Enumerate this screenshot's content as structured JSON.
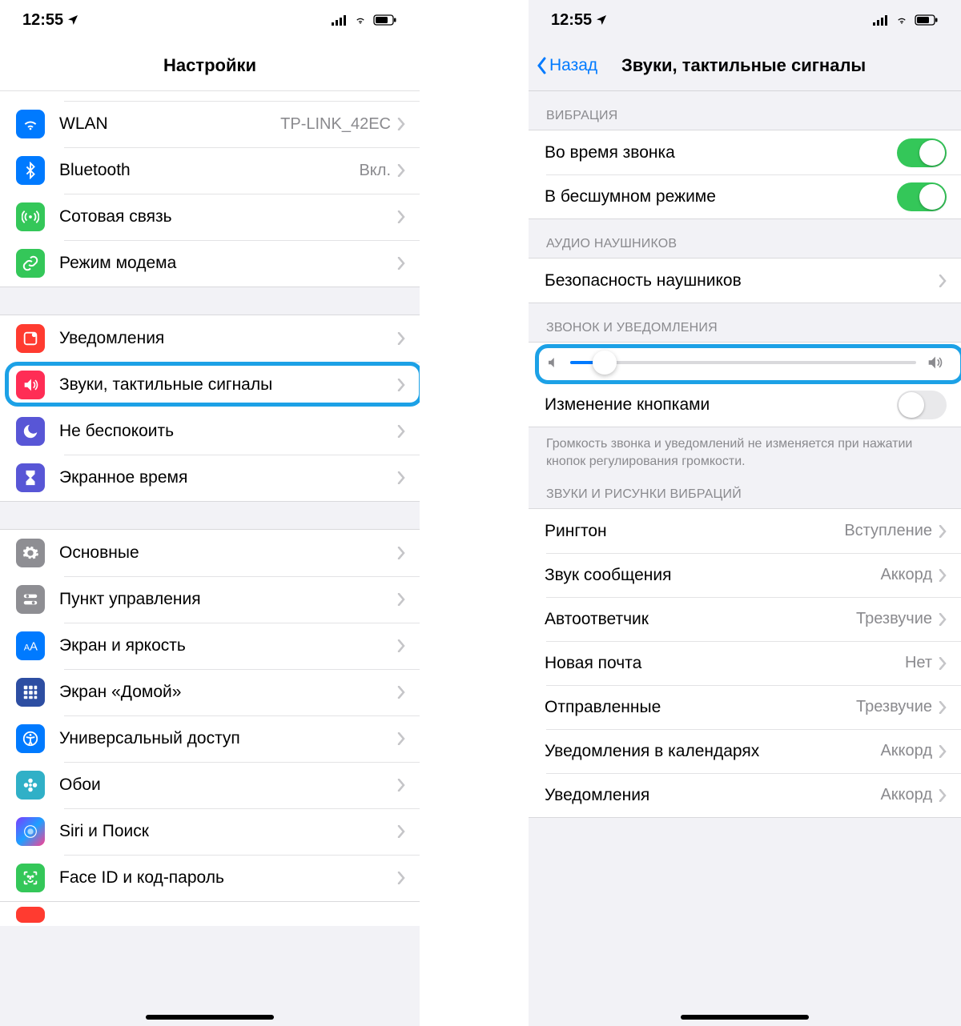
{
  "statusbar": {
    "time": "12:55"
  },
  "left": {
    "nav_title": "Настройки",
    "rows": {
      "wlan": {
        "label": "WLAN",
        "value": "TP-LINK_42EC",
        "icon_bg": "#007aff"
      },
      "bluetooth": {
        "label": "Bluetooth",
        "value": "Вкл.",
        "icon_bg": "#007aff"
      },
      "cellular": {
        "label": "Сотовая связь",
        "icon_bg": "#34c759"
      },
      "hotspot": {
        "label": "Режим модема",
        "icon_bg": "#34c759"
      },
      "notifications": {
        "label": "Уведомления",
        "icon_bg": "#ff3b30"
      },
      "sounds": {
        "label": "Звуки, тактильные сигналы",
        "icon_bg": "#ff2d55"
      },
      "dnd": {
        "label": "Не беспокоить",
        "icon_bg": "#5856d6"
      },
      "screentime": {
        "label": "Экранное время",
        "icon_bg": "#5856d6"
      },
      "general": {
        "label": "Основные",
        "icon_bg": "#8e8e93"
      },
      "controlcenter": {
        "label": "Пункт управления",
        "icon_bg": "#8e8e93"
      },
      "display": {
        "label": "Экран и яркость",
        "icon_bg": "#007aff"
      },
      "homescreen": {
        "label": "Экран «Домой»",
        "icon_bg": "#2d4ea2"
      },
      "accessibility": {
        "label": "Универсальный доступ",
        "icon_bg": "#007aff"
      },
      "wallpaper": {
        "label": "Обои",
        "icon_bg": "#30b0c7"
      },
      "siri": {
        "label": "Siri и Поиск",
        "icon_bg": "#1c1c1e"
      },
      "faceid": {
        "label": "Face ID и код-пароль",
        "icon_bg": "#34c759"
      }
    }
  },
  "right": {
    "back_label": "Назад",
    "nav_title": "Звуки, тактильные сигналы",
    "headers": {
      "vibration": "ВИБРАЦИЯ",
      "audio": "АУДИО НАУШНИКОВ",
      "ringer": "ЗВОНОК И УВЕДОМЛЕНИЯ",
      "sounds": "ЗВУКИ И РИСУНКИ ВИБРАЦИЙ"
    },
    "rows": {
      "vibrate_ring": "Во время звонка",
      "vibrate_silent": "В бесшумном режиме",
      "headphone_safety": "Безопасность наушников",
      "change_buttons": "Изменение кнопками",
      "ringtone": {
        "label": "Рингтон",
        "value": "Вступление"
      },
      "text_tone": {
        "label": "Звук сообщения",
        "value": "Аккорд"
      },
      "voicemail": {
        "label": "Автоответчик",
        "value": "Трезвучие"
      },
      "new_mail": {
        "label": "Новая почта",
        "value": "Нет"
      },
      "sent_mail": {
        "label": "Отправленные",
        "value": "Трезвучие"
      },
      "calendar": {
        "label": "Уведомления в календарях",
        "value": "Аккорд"
      },
      "reminders": {
        "label": "Уведомления",
        "value": "Аккорд"
      }
    },
    "footer_buttons": "Громкость звонка и уведомлений не изменяется при нажатии кнопок регулирования громкости.",
    "slider_percent": 10
  }
}
